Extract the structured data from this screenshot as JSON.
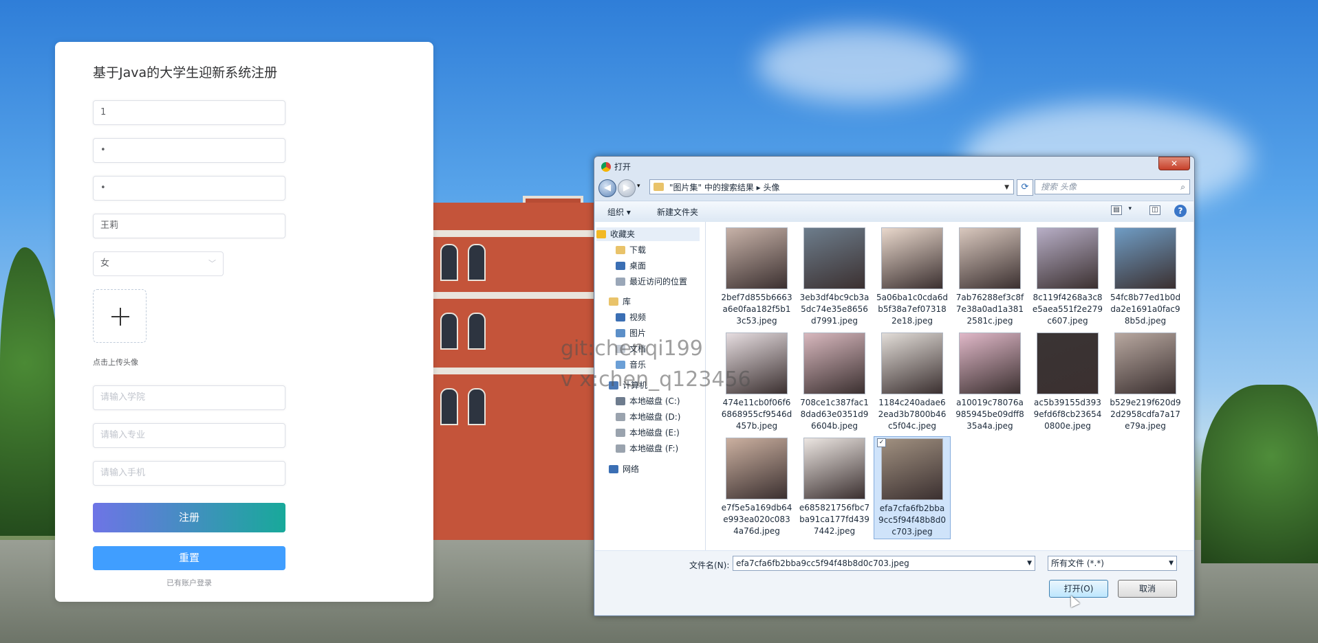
{
  "form": {
    "title": "基于Java的大学生迎新系统注册",
    "account_value": "1",
    "password_value": "•",
    "confirm_password_value": "•",
    "name_value": "王莉",
    "gender_value": "女",
    "upload_tip": "点击上传头像",
    "college_placeholder": "请输入学院",
    "major_placeholder": "请输入专业",
    "phone_placeholder": "请输入手机",
    "register_label": "注册",
    "reset_label": "重置",
    "login_link": "已有账户登录"
  },
  "watermark": {
    "line1": "git:chenqi199",
    "line2": "v x:chen_q123456"
  },
  "dialog": {
    "title": "打开",
    "close_label": "✕",
    "breadcrumb": "\"图片集\" 中的搜索结果  ▸  头像",
    "search_placeholder": "搜索 头像",
    "toolbar": {
      "organize": "组织 ▾",
      "new_folder": "新建文件夹"
    },
    "nav": [
      {
        "label": "收藏夹",
        "indent": 0,
        "icon": "star-icon",
        "color": "#f2b824",
        "selected": true
      },
      {
        "label": "下载",
        "indent": 1,
        "icon": "download-folder-icon",
        "color": "#e9c36a"
      },
      {
        "label": "桌面",
        "indent": 1,
        "icon": "desktop-icon",
        "color": "#3b6fb4"
      },
      {
        "label": "最近访问的位置",
        "indent": 1,
        "icon": "recent-places-icon",
        "color": "#9aa7b8"
      },
      {
        "label": "库",
        "indent": 0,
        "icon": "library-icon",
        "color": "#e9c36a"
      },
      {
        "label": "视频",
        "indent": 1,
        "icon": "video-icon",
        "color": "#3b6fb4"
      },
      {
        "label": "图片",
        "indent": 1,
        "icon": "pictures-icon",
        "color": "#5c8fc8"
      },
      {
        "label": "文档",
        "indent": 1,
        "icon": "documents-icon",
        "color": "#c5ccd6"
      },
      {
        "label": "音乐",
        "indent": 1,
        "icon": "music-icon",
        "color": "#6b9fd6"
      },
      {
        "label": "计算机",
        "indent": 0,
        "icon": "computer-icon",
        "color": "#4a78b5"
      },
      {
        "label": "本地磁盘 (C:)",
        "indent": 1,
        "icon": "drive-c-icon",
        "color": "#6e7c8e"
      },
      {
        "label": "本地磁盘 (D:)",
        "indent": 1,
        "icon": "drive-d-icon",
        "color": "#9aa3ae"
      },
      {
        "label": "本地磁盘 (E:)",
        "indent": 1,
        "icon": "drive-e-icon",
        "color": "#9aa3ae"
      },
      {
        "label": "本地磁盘 (F:)",
        "indent": 1,
        "icon": "drive-f-icon",
        "color": "#9aa3ae"
      },
      {
        "label": "网络",
        "indent": 0,
        "icon": "network-icon",
        "color": "#3b6fb4"
      }
    ],
    "files": [
      {
        "name": "2bef7d855b6663a6e0faa182f5b13c53.jpeg",
        "color": "#c7b2a8"
      },
      {
        "name": "3eb3df4bc9cb3a5dc74e35e8656d7991.jpeg",
        "color": "#6d7d8c"
      },
      {
        "name": "5a06ba1c0cda6db5f38a7ef073182e18.jpeg",
        "color": "#e9d8cc"
      },
      {
        "name": "7ab76288ef3c8f7e38a0ad1a3812581c.jpeg",
        "color": "#d9c8be"
      },
      {
        "name": "8c119f4268a3c8e5aea551f2e279c607.jpeg",
        "color": "#b7aec6"
      },
      {
        "name": "54fc8b77ed1b0dda2e1691a0fac98b5d.jpeg",
        "color": "#6f9cc4"
      },
      {
        "name": "474e11cb0f06f66868955cf9546d457b.jpeg",
        "color": "#e6dde0"
      },
      {
        "name": "708ce1c387fac18dad63e0351d96604b.jpeg",
        "color": "#d8b8be"
      },
      {
        "name": "1184c240adae62ead3b7800b46c5f04c.jpeg",
        "color": "#e2ddd8"
      },
      {
        "name": "a10019c78076a985945be09dff835a4a.jpeg",
        "color": "#e0b8c8"
      },
      {
        "name": "ac5b39155d3939efd6f8cb236540800e.jpeg",
        "color": "#3a3434"
      },
      {
        "name": "b529e219f620d92d2958cdfa7a17e79a.jpeg",
        "color": "#b8a8a0"
      },
      {
        "name": "e7f5e5a169db64e993ea020c0834a76d.jpeg",
        "color": "#cbb0a0"
      },
      {
        "name": "e685821756fbc7ba91ca177fd4397442.jpeg",
        "color": "#ece6e2"
      },
      {
        "name": "efa7cfa6fb2bba9cc5f94f48b8d0c703.jpeg",
        "color": "#a09080",
        "selected": true
      }
    ],
    "filename_label": "文件名(N):",
    "filename_value": "efa7cfa6fb2bba9cc5f94f48b8d0c703.jpeg",
    "filetype_value": "所有文件 (*.*)",
    "open_label": "打开(O)",
    "cancel_label": "取消"
  }
}
